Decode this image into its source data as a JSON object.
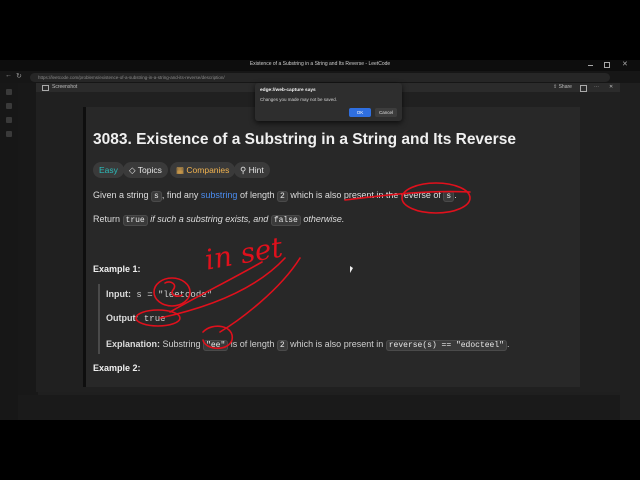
{
  "browser": {
    "window_title": "Existence of a Substring in a String and Its Reverse - LeetCode",
    "url": "https://leetcode.com/problems/existence-of-a-substring-in-a-string-and-its-reverse/description/"
  },
  "viewer": {
    "title": "Screenshot",
    "share_label": "Share"
  },
  "dialog": {
    "title": "edge://web-capture says",
    "message": "Changes you made may not be saved.",
    "ok_label": "OK",
    "cancel_label": "Cancel"
  },
  "problem": {
    "title": "3083. Existence of a Substring in a String and Its Reverse",
    "tags": [
      "Easy",
      "Topics",
      "Companies",
      "Hint"
    ],
    "desc_p1_a": "Given a string",
    "desc_p1_code_s": "s",
    "desc_p1_b": ", find any",
    "desc_p1_link": "substring",
    "desc_p1_c": "of length",
    "desc_p1_code_2": "2",
    "desc_p1_d": "which is also present in the reverse of",
    "desc_p1_code_s2": "s",
    "desc_p1_e": ".",
    "desc_p2_a": "Return",
    "desc_p2_code_true": "true",
    "desc_p2_b": "if such a substring exists, and",
    "desc_p2_code_false": "false",
    "desc_p2_c": "otherwise.",
    "example1_title": "Example 1:",
    "input_label": "Input:",
    "input_value": "s = \"leetcode\"",
    "output_label": "Output:",
    "output_value": "true",
    "explanation_label": "Explanation:",
    "explanation_a": "Substring",
    "explanation_code_ee": "\"ee\"",
    "explanation_b": "is of length",
    "explanation_code_2": "2",
    "explanation_c": "which is also present in",
    "explanation_code_rev": "reverse(s) == \"edocteel\"",
    "explanation_d": ".",
    "example2_title": "Example 2:"
  },
  "annotation": {
    "color": "#e0101c",
    "text": "in set"
  },
  "colors": {
    "link": "#4a8cf0",
    "easy": "#2cbbba",
    "companies": "#f3b44f",
    "accent_ok": "#2f6fe0"
  }
}
